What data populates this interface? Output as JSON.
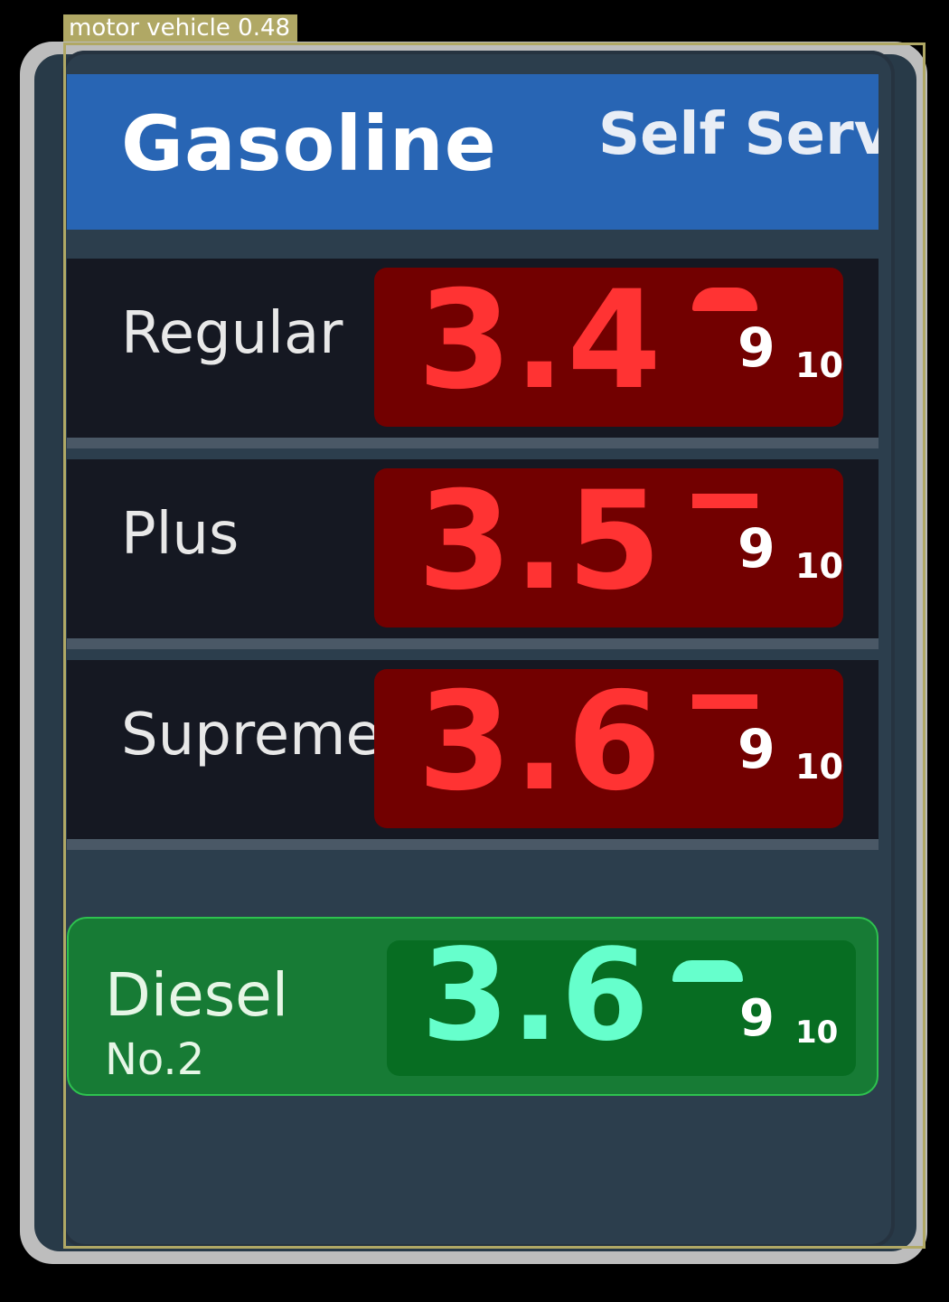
{
  "sign": {
    "header_title": "Gasoline",
    "header_subtitle": "Self Serve",
    "rows": [
      {
        "grade": "Regular",
        "price_main": "3.4",
        "price_digit": "9",
        "price_fraction": "10"
      },
      {
        "grade": "Plus",
        "price_main": "3.5",
        "price_digit": "9",
        "price_fraction": "10"
      },
      {
        "grade": "Supreme",
        "price_main": "3.6",
        "price_digit": "9",
        "price_fraction": "10"
      }
    ],
    "diesel": {
      "label": "Diesel",
      "sublabel": "No.2",
      "price_main": "3.6",
      "price_digit": "9",
      "price_fraction": "10"
    }
  },
  "detection": {
    "label": "motor vehicle",
    "score": "0.48",
    "label_text": "motor vehicle 0.48"
  },
  "colors": {
    "header": "#2865b4",
    "price_red": "#ff3333",
    "price_box": "#720000",
    "diesel_bg": "#177b35",
    "diesel_price": "#66ffcc",
    "detection_box": "#b0a865"
  }
}
